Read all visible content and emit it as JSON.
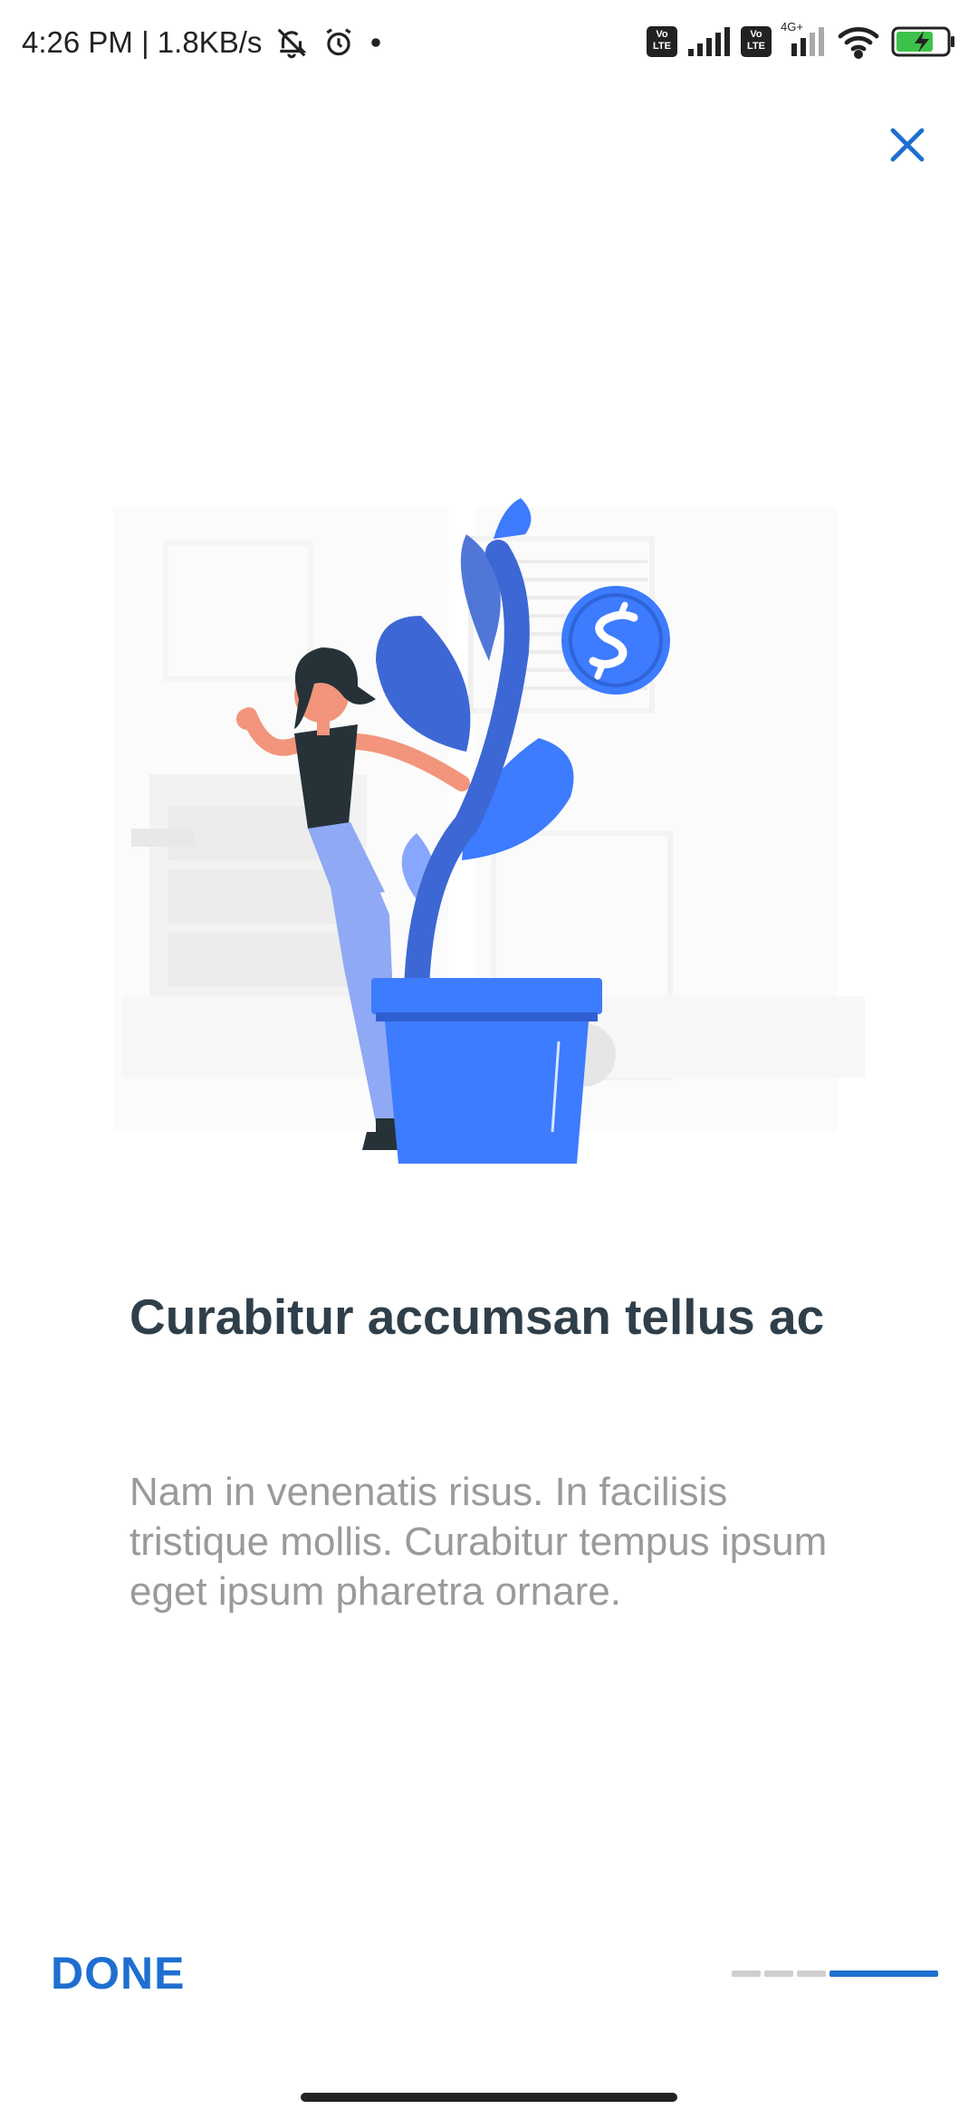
{
  "status_bar": {
    "time_speed": "4:26 PM | 1.8KB/s",
    "volte_label": "Vo LTE",
    "network_label": "4G+",
    "icons": [
      "bell-off-icon",
      "alarm-icon",
      "dot-icon",
      "volte-icon",
      "signal-icon",
      "volte-icon",
      "signal-icon",
      "wifi-icon",
      "battery-charging-icon"
    ]
  },
  "close_icon": "close-icon",
  "onboarding": {
    "headline": "Curabitur accumsan tellus ac",
    "body": "Nam in venenatis risus. In facilisis tristique mollis. Curabitur tempus ipsum eget ipsum pharetra ornare.",
    "done_label": "DONE",
    "page_count": 4,
    "current_page": 4
  },
  "colors": {
    "accent": "#1e6fcf",
    "illustration_blue": "#3d7bff",
    "headline": "#2f3f4a",
    "body": "#9a9a9a"
  }
}
